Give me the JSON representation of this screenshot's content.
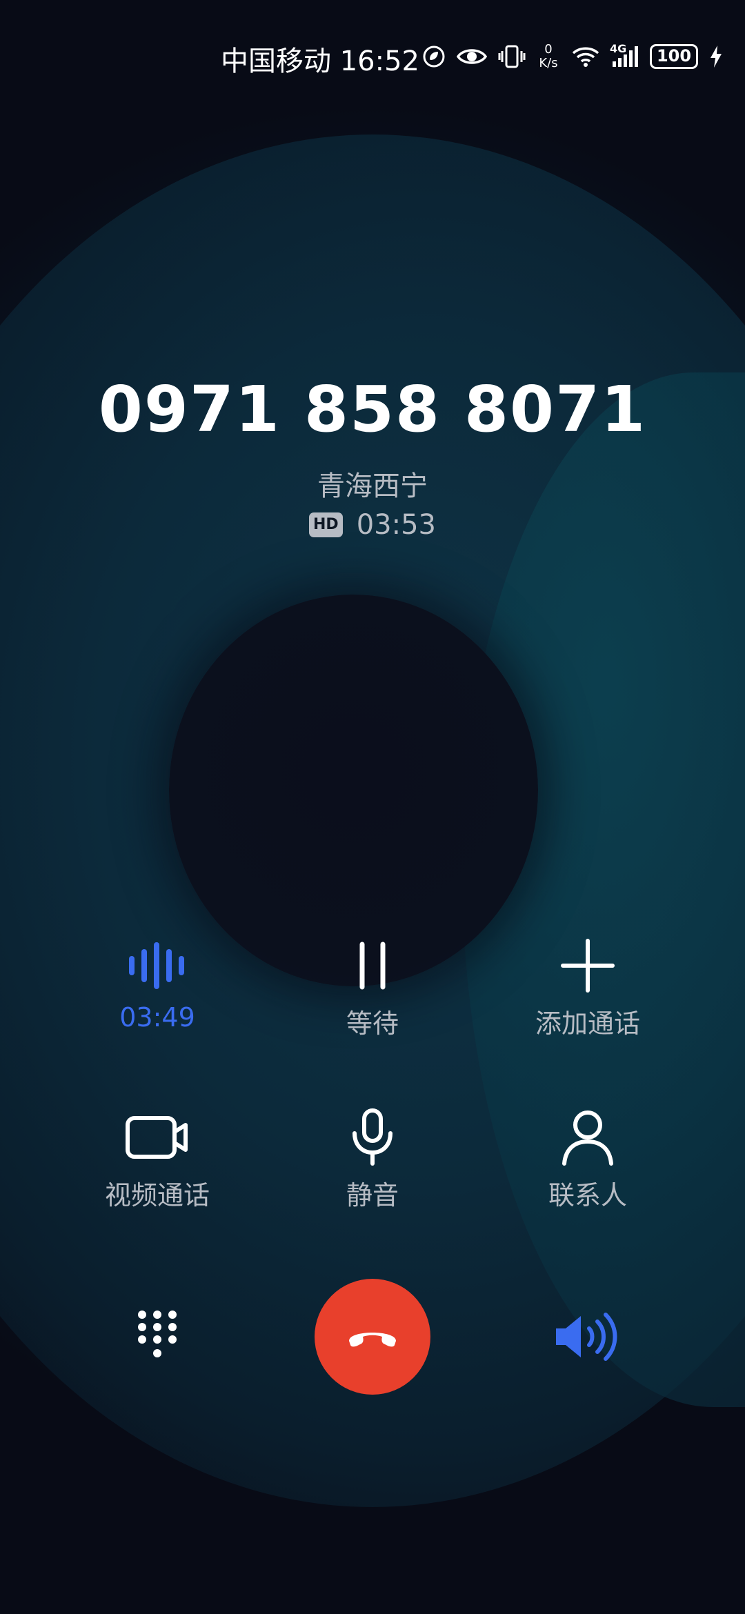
{
  "status_bar": {
    "carrier": "中国移动",
    "time": "16:52",
    "net_speed_value": "0",
    "net_speed_unit": "K/s",
    "network_type": "4G",
    "battery": "100",
    "icons": [
      "nfc-leaf-icon",
      "eye-comfort-icon",
      "vibrate-icon",
      "wifi-icon",
      "signal-icon",
      "battery-icon",
      "charging-icon"
    ]
  },
  "call": {
    "number": "0971 858 8071",
    "location": "青海西宁",
    "hd_label": "HD",
    "duration": "03:53"
  },
  "controls": {
    "recording_time": "03:49",
    "hold_label": "等待",
    "add_call_label": "添加通话",
    "video_call_label": "视频通话",
    "mute_label": "静音",
    "contacts_label": "联系人"
  },
  "colors": {
    "accent": "#3a6cf0",
    "end_call": "#e8402c",
    "label_gray": "#b7bcc4"
  }
}
